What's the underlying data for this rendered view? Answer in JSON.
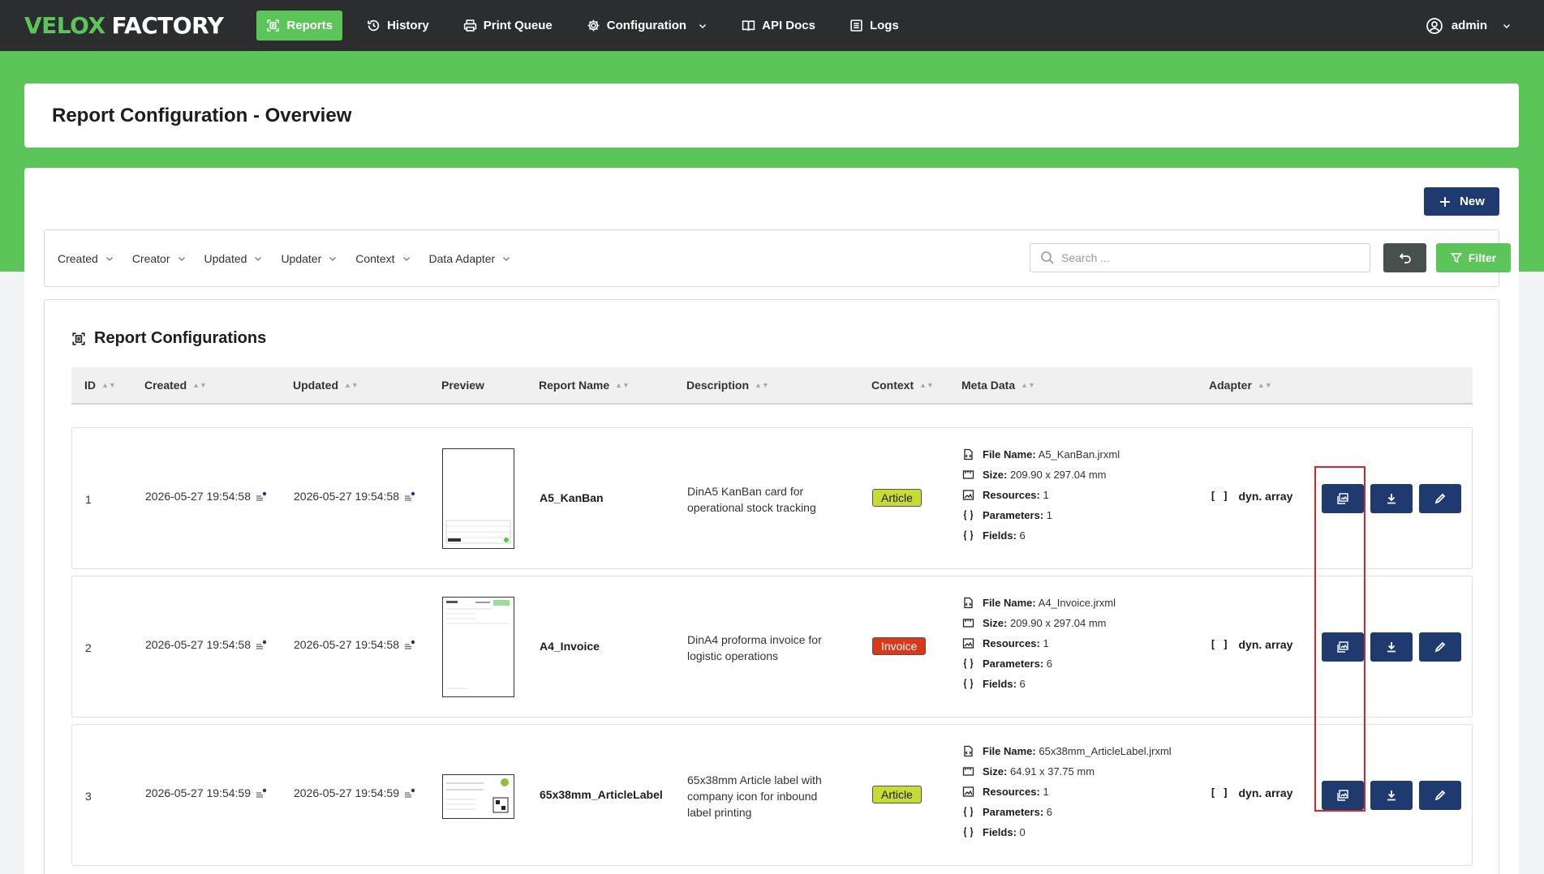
{
  "brand": {
    "part1": "VELOX",
    "part2": "FACTORY"
  },
  "nav": {
    "items": [
      {
        "label": "Reports",
        "icon": "report-icon",
        "active": true
      },
      {
        "label": "History",
        "icon": "history-icon"
      },
      {
        "label": "Print Queue",
        "icon": "printer-icon"
      },
      {
        "label": "Configuration",
        "icon": "gear-icon"
      },
      {
        "label": "API Docs",
        "icon": "book-icon"
      },
      {
        "label": "Logs",
        "icon": "list-icon"
      }
    ],
    "user": "admin"
  },
  "page_title": "Report Configuration - Overview",
  "toolbar": {
    "new_label": "New",
    "filters": [
      "Created",
      "Creator",
      "Updated",
      "Updater",
      "Context",
      "Data Adapter"
    ],
    "search_placeholder": "Search ...",
    "filter_label": "Filter"
  },
  "section_title": "Report Configurations",
  "columns": [
    "ID",
    "Created",
    "Updated",
    "Preview",
    "Report Name",
    "Description",
    "Context",
    "Meta Data",
    "Adapter"
  ],
  "meta_labels": {
    "file_name": "File Name:",
    "size": "Size:",
    "resources": "Resources:",
    "parameters": "Parameters:",
    "fields": "Fields:"
  },
  "rows": [
    {
      "id": "1",
      "created": "2026-05-27 19:54:58",
      "updated": "2026-05-27 19:54:58",
      "report_name": "A5_KanBan",
      "description": "DinA5 KanBan card for operational stock tracking",
      "context": "Article",
      "file_name": "A5_KanBan.jrxml",
      "size": "209.90 x 297.04 mm",
      "resources": "1",
      "parameters": "1",
      "fields": "6",
      "adapter": "dyn. array"
    },
    {
      "id": "2",
      "created": "2026-05-27 19:54:58",
      "updated": "2026-05-27 19:54:58",
      "report_name": "A4_Invoice",
      "description": "DinA4 proforma invoice for logistic operations",
      "context": "Invoice",
      "file_name": "A4_Invoice.jrxml",
      "size": "209.90 x 297.04 mm",
      "resources": "1",
      "parameters": "6",
      "fields": "6",
      "adapter": "dyn. array"
    },
    {
      "id": "3",
      "created": "2026-05-27 19:54:59",
      "updated": "2026-05-27 19:54:59",
      "report_name": "65x38mm_ArticleLabel",
      "description": "65x38mm Article label with company icon for inbound label printing",
      "context": "Article",
      "file_name": "65x38mm_ArticleLabel.jrxml",
      "size": "64.91 x 37.75 mm",
      "resources": "1",
      "parameters": "6",
      "fields": "0",
      "adapter": "dyn. array"
    }
  ],
  "colors": {
    "navbar": "#2b2d2f",
    "accent_green": "#5cc55a",
    "button_navy": "#1f3a6e",
    "badge_article": "#c6dc34",
    "badge_invoice": "#d9391b",
    "highlight_red": "#d9252a"
  }
}
